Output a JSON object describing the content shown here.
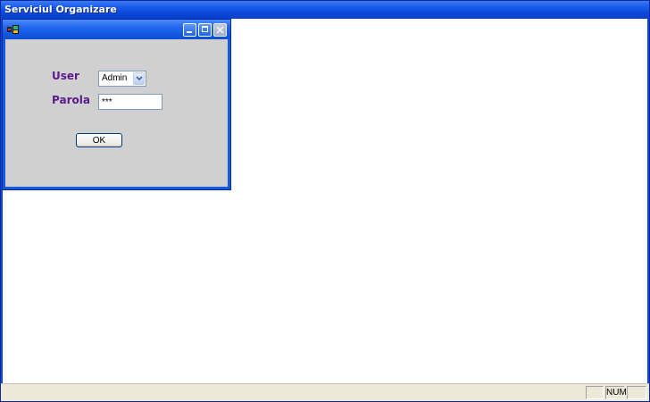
{
  "app": {
    "title": "Serviciul Organizare"
  },
  "statusbar": {
    "num": "NUM"
  },
  "login_dialog": {
    "user_label": "User",
    "password_label": "Parola",
    "user_value": "Admin",
    "password_value": "***",
    "ok_label": "OK"
  },
  "icons": {
    "app": "app-icon",
    "minimize": "minimize-icon",
    "maximize": "maximize-icon",
    "close": "close-icon",
    "dropdown": "chevron-down-icon"
  },
  "colors": {
    "titlebar": "#0b47d9",
    "dialog_bg": "#d0d0d0",
    "label_text": "#5a1a8c"
  }
}
